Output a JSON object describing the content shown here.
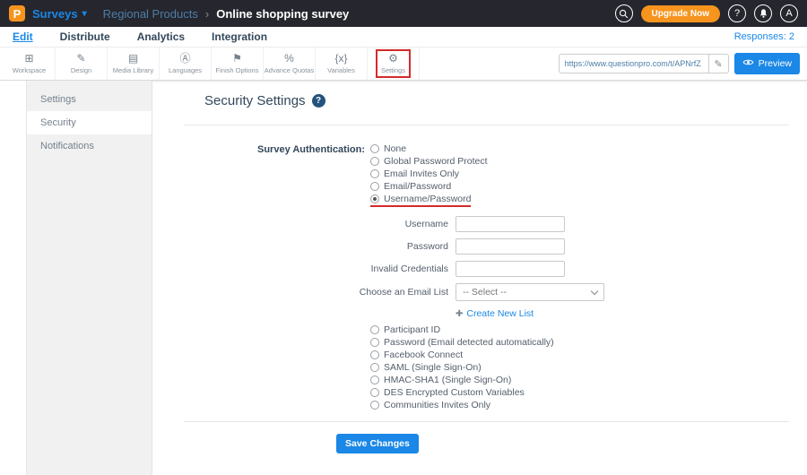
{
  "topbar": {
    "logo_letter": "P",
    "product_label": "Surveys",
    "product_caret": "▾",
    "breadcrumb": {
      "parent": "Regional Products",
      "separator": "›",
      "current": "Online shopping survey"
    },
    "upgrade_label": "Upgrade Now",
    "help_glyph": "?",
    "avatar_initial": "A"
  },
  "nav": {
    "tabs": [
      {
        "label": "Edit",
        "active": true
      },
      {
        "label": "Distribute",
        "active": false
      },
      {
        "label": "Analytics",
        "active": false
      },
      {
        "label": "Integration",
        "active": false
      }
    ],
    "responses_label": "Responses: 2"
  },
  "toolbar": {
    "items": [
      {
        "label": "Workspace",
        "glyph": "⊞"
      },
      {
        "label": "Design",
        "glyph": "✎"
      },
      {
        "label": "Media Library",
        "glyph": "▤"
      },
      {
        "label": "Languages",
        "glyph": "Ⓐ"
      },
      {
        "label": "Finish Options",
        "glyph": "⚑"
      },
      {
        "label": "Advance Quotas",
        "glyph": "%"
      },
      {
        "label": "Variables",
        "glyph": "{x}"
      },
      {
        "label": "Settings",
        "glyph": "⚙",
        "annotated": true
      }
    ],
    "url_value": "https://www.questionpro.com/t/APNrfZ",
    "edit_glyph": "✎",
    "preview_label": "Preview"
  },
  "sidebar": {
    "items": [
      {
        "label": "Settings",
        "active": false
      },
      {
        "label": "Security",
        "active": true
      },
      {
        "label": "Notifications",
        "active": false
      }
    ]
  },
  "main": {
    "title": "Security Settings",
    "help_glyph": "?",
    "auth_label": "Survey Authentication:",
    "auth_options_top": [
      {
        "label": "None",
        "selected": false
      },
      {
        "label": "Global Password Protect",
        "selected": false
      },
      {
        "label": "Email Invites Only",
        "selected": false
      },
      {
        "label": "Email/Password",
        "selected": false
      },
      {
        "label": "Username/Password",
        "selected": true,
        "annotated": true
      }
    ],
    "fields": [
      {
        "label": "Username",
        "value": ""
      },
      {
        "label": "Password",
        "value": ""
      },
      {
        "label": "Invalid Credentials",
        "value": ""
      },
      {
        "label": "Choose an Email List",
        "value": "-- Select --"
      }
    ],
    "create_list_plus": "✚",
    "create_list_label": "Create New List",
    "auth_options_bottom": [
      {
        "label": "Participant ID",
        "selected": false
      },
      {
        "label": "Password (Email detected automatically)",
        "selected": false
      },
      {
        "label": "Facebook Connect",
        "selected": false
      },
      {
        "label": "SAML (Single Sign-On)",
        "selected": false
      },
      {
        "label": "HMAC-SHA1 (Single Sign-On)",
        "selected": false
      },
      {
        "label": "DES Encrypted Custom Variables",
        "selected": false
      },
      {
        "label": "Communities Invites Only",
        "selected": false
      }
    ],
    "save_label": "Save Changes"
  },
  "colors": {
    "accent_blue": "#1b87e6",
    "upgrade_orange": "#f7941e",
    "topbar_bg": "#26262e",
    "annotation_red": "#d42a2a"
  }
}
